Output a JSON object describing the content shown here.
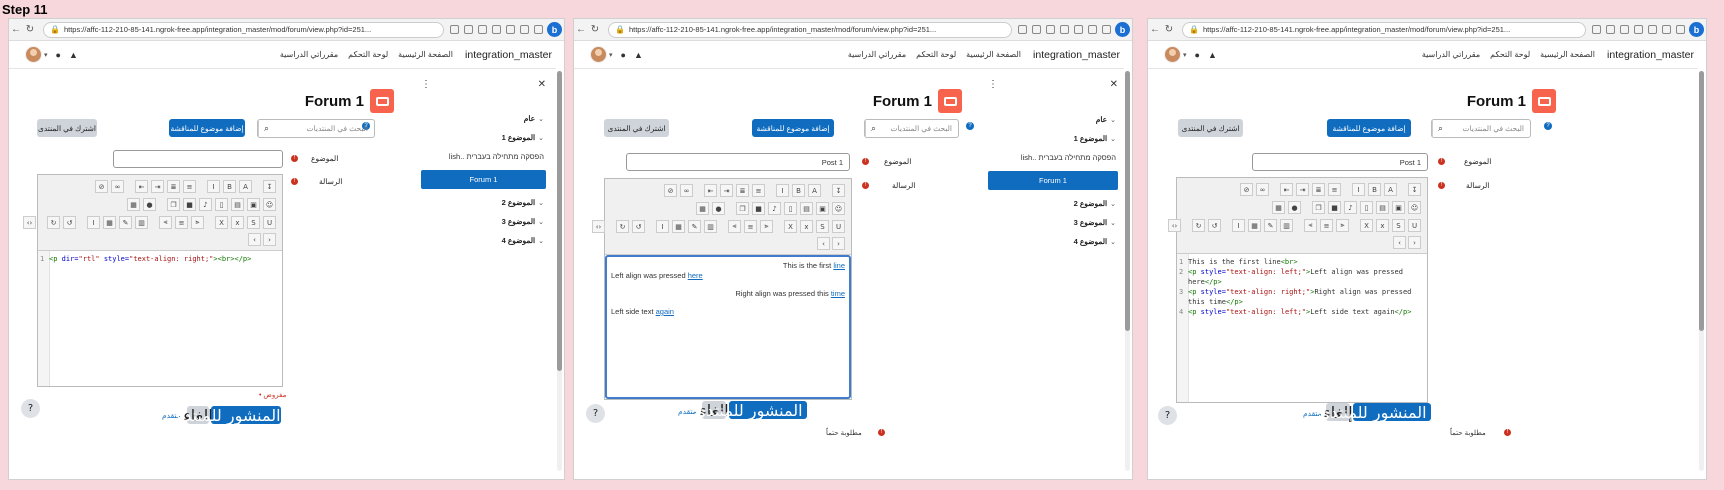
{
  "step_label": "Step 11",
  "browser": {
    "url": "https://affc-112-210-85-141.ngrok-free.app/integration_master/mod/forum/view.php?id=251..."
  },
  "site_nav": {
    "brand": "integration_master",
    "links": [
      "الصفحة الرئيسية",
      "لوحة التحكم",
      "مقرراتي الدراسية"
    ]
  },
  "sidebar": {
    "items": [
      {
        "label": "عام",
        "type": "section"
      },
      {
        "label": "الموضوع 1",
        "type": "section"
      },
      {
        "label": "הפסקה מתחילה בעברית ..lish",
        "type": "plain"
      },
      {
        "label": "Forum 1",
        "type": "active"
      },
      {
        "label": "الموضوع 2",
        "type": "section"
      },
      {
        "label": "الموضوع 3",
        "type": "section"
      },
      {
        "label": "الموضوع 4",
        "type": "section"
      }
    ]
  },
  "forum": {
    "title": "Forum 1",
    "search_placeholder": "البحث في المنتديات",
    "add_topic_label": "إضافة موضوع للمناقشة",
    "subscribe_label": "اشترك في المنتدى"
  },
  "form": {
    "subject_label": "الموضوع",
    "message_label": "الرسالة",
    "subject_value_empty": "",
    "subject_value": "Post 1",
    "post_button": "أضف المنشور للمنتدى",
    "cancel_button_p1": "الغاء",
    "cancel_button_p2": "الغاء",
    "cancel_button_p3": "إلغاء",
    "advanced_link": "متقدم",
    "required_note_p1": "• مفروض",
    "required_note": "مطلوبة حتماً"
  },
  "panel1": {
    "code_lines": [
      {
        "n": "1",
        "parts": [
          [
            "tag",
            "<p "
          ],
          [
            "attr",
            "dir="
          ],
          [
            "str",
            "\"rtl\""
          ],
          [
            "tag",
            " "
          ],
          [
            "attr",
            "style="
          ],
          [
            "str",
            "\"text-align: right;\""
          ],
          [
            "tag",
            "><br></p>"
          ]
        ]
      }
    ]
  },
  "panel2": {
    "lines": [
      {
        "text": "This is the first ",
        "link": "line",
        "align": "right"
      },
      {
        "text": "Left align was pressed ",
        "link": "here",
        "align": "left"
      },
      {
        "text": "Right align was pressed this ",
        "link": "time",
        "align": "right"
      },
      {
        "text": "Left side text ",
        "link": "again",
        "align": "left"
      }
    ]
  },
  "panel3": {
    "code_lines": [
      {
        "n": "1",
        "parts": [
          [
            "plain",
            "This is the first line"
          ],
          [
            "tag",
            "<br>"
          ]
        ]
      },
      {
        "n": "2",
        "parts": [
          [
            "tag",
            "<p "
          ],
          [
            "attr",
            "style="
          ],
          [
            "str",
            "\"text-align: left;\""
          ],
          [
            "tag",
            ">"
          ],
          [
            "plain",
            "Left align was pressed"
          ]
        ]
      },
      {
        "n": "",
        "parts": [
          [
            "plain",
            "here"
          ],
          [
            "tag",
            "</p>"
          ]
        ]
      },
      {
        "n": "3",
        "parts": [
          [
            "tag",
            "<p "
          ],
          [
            "attr",
            "style="
          ],
          [
            "str",
            "\"text-align: right;\""
          ],
          [
            "tag",
            ">"
          ],
          [
            "plain",
            "Right align was pressed"
          ]
        ]
      },
      {
        "n": "",
        "parts": [
          [
            "plain",
            "this time"
          ],
          [
            "tag",
            "</p>"
          ]
        ]
      },
      {
        "n": "4",
        "parts": [
          [
            "tag",
            "<p "
          ],
          [
            "attr",
            "style="
          ],
          [
            "str",
            "\"text-align: left;\""
          ],
          [
            "tag",
            ">"
          ],
          [
            "plain",
            "Left side text again"
          ],
          [
            "tag",
            "</p>"
          ]
        ]
      }
    ]
  }
}
